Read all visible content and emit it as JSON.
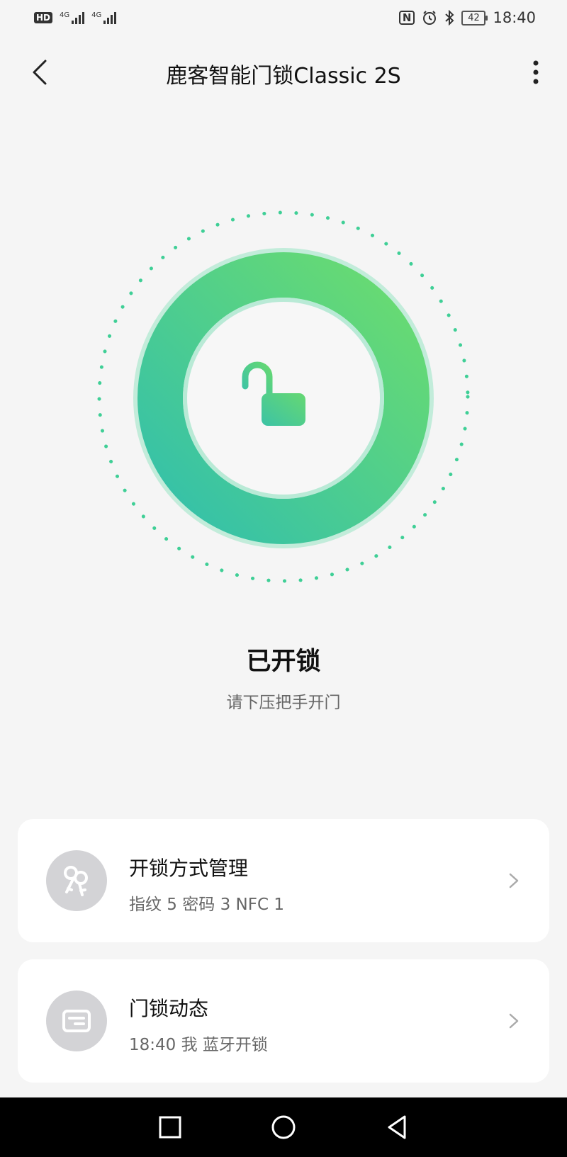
{
  "status_bar": {
    "hd": "HD",
    "signal_1": "4G",
    "signal_2": "4G",
    "nfc": "N",
    "battery": "42",
    "time": "18:40"
  },
  "header": {
    "title": "鹿客智能门锁Classic 2S"
  },
  "lock": {
    "status": "已开锁",
    "hint": "请下压把手开门"
  },
  "cards": {
    "unlock_methods": {
      "title": "开锁方式管理",
      "subtitle": "指纹 5  密码 3  NFC 1",
      "icon": "keys-icon"
    },
    "lock_activity": {
      "title": "门锁动态",
      "subtitle": "18:40 我 蓝牙开锁",
      "icon": "log-card-icon"
    }
  },
  "colors": {
    "ring_start": "#3cc3a6",
    "ring_end": "#64d873",
    "card_bg": "#ffffff",
    "page_bg": "#f5f5f5",
    "icon_circle": "#d3d3d6"
  }
}
